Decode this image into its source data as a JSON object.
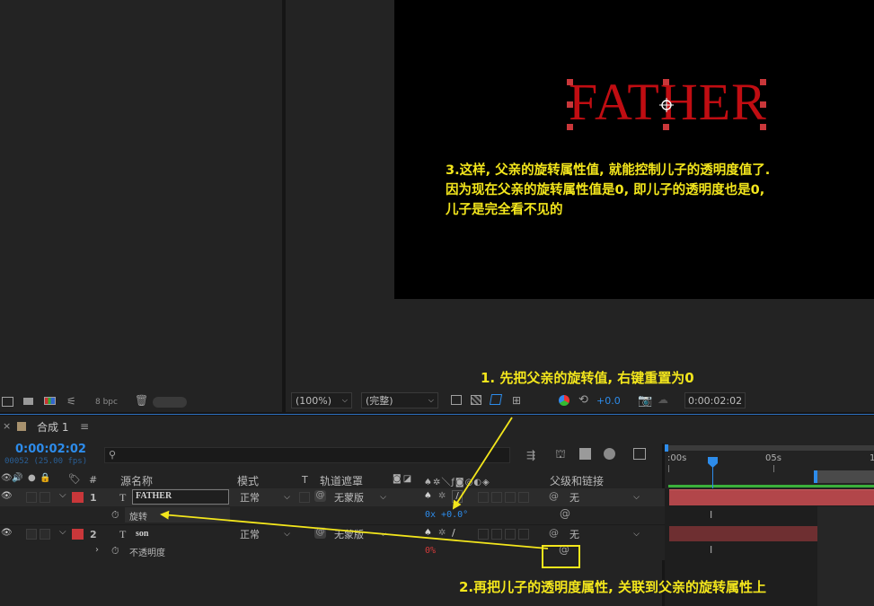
{
  "project_footer": {
    "bpc": "8 bpc"
  },
  "viewer": {
    "comp_text": "FATHER",
    "zoom": "(100%)",
    "resolution": "(完整)",
    "exposure": "+0.0",
    "timecode": "0:00:02:02"
  },
  "timeline": {
    "tab_title": "合成 1",
    "current_time": "0:00:02:02",
    "frame_info": "00052 (25.00 fps)",
    "columns": {
      "hash": "#",
      "source_name": "源名称",
      "mode": "模式",
      "t": "T",
      "trkmat": "轨道遮罩",
      "parent": "父级和链接"
    },
    "ruler": {
      "t0": ":00s",
      "t5": "05s",
      "t10": "1"
    },
    "layers": [
      {
        "index": "1",
        "type_glyph": "T",
        "name": "FATHER",
        "mode": "正常",
        "trkmat": "无蒙版",
        "parent": "无",
        "label_color": "#c9373a",
        "property": {
          "name": "旋转",
          "value": "0x +0.0°"
        }
      },
      {
        "index": "2",
        "type_glyph": "T",
        "name": "son",
        "mode": "正常",
        "trkmat": "无蒙版",
        "parent": "无",
        "label_color": "#c9373a",
        "property": {
          "name": "不透明度",
          "value": "0%"
        }
      }
    ]
  },
  "annotations": {
    "step1": "1. 先把父亲的旋转值, 右键重置为0",
    "step2": "2.再把儿子的透明度属性, 关联到父亲的旋转属性上",
    "step3_line1": "3.这样, 父亲的旋转属性值, 就能控制儿子的透明度值了.",
    "step3_line2": "因为现在父亲的旋转属性值是0, 即儿子的透明度也是0,",
    "step3_line3": "儿子是完全看不见的",
    "color": "#f3e61c"
  },
  "colors": {
    "accent_blue": "#2d8ceb",
    "layer_bar": "#b2464a",
    "comp_text_red": "#c00d12",
    "annotation_yellow": "#f3e61c"
  }
}
